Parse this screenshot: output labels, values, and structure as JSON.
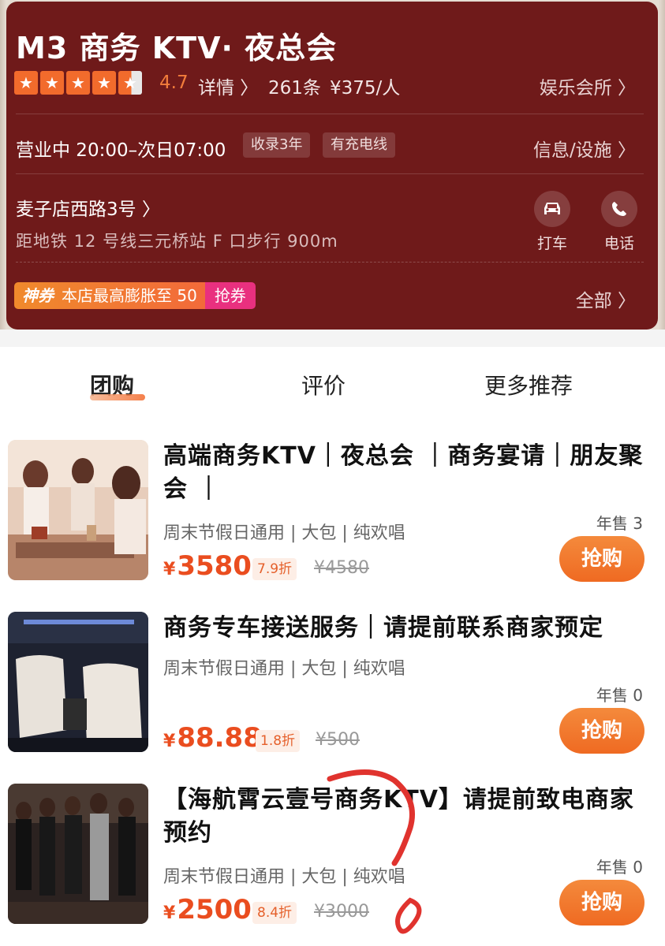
{
  "shop": {
    "name": "M3 商务 KTV· 夜总会",
    "rating": "4.7",
    "detail_link": "详情 〉",
    "review_count": "261条",
    "price_per_person": "¥375/人",
    "category_link": "娱乐会所 〉",
    "status": "营业中 20:00–次日07:00",
    "tags": [
      "收录3年",
      "有充电线"
    ],
    "info_link": "信息/设施 〉",
    "address": "麦子店西路3号 〉",
    "metro": "距地铁 12 号线三元桥站 F 口步行 900m",
    "actions": [
      {
        "label": "打车",
        "icon": "car-icon"
      },
      {
        "label": "电话",
        "icon": "phone-icon"
      }
    ],
    "coupon": {
      "badge": "神券",
      "text": "本店最高膨胀至 50",
      "action": "抢券"
    },
    "all_link": "全部 〉"
  },
  "tabs": [
    {
      "label": "团购",
      "active": true
    },
    {
      "label": "评价",
      "active": false
    },
    {
      "label": "更多推荐",
      "active": false
    }
  ],
  "deals": [
    {
      "title": "高端商务KTV｜夜总会 ｜商务宴请｜朋友聚会 ｜",
      "subtitle": "周末节假日通用 | 大包 | 纯欢唱",
      "sold": "年售 3",
      "price": "3580",
      "currency": "¥",
      "discount": "7.9折",
      "original_price": "¥4580",
      "button": "抢购"
    },
    {
      "title": "商务专车接送服务｜请提前联系商家预定",
      "subtitle": "周末节假日通用 | 大包 | 纯欢唱",
      "sold": "年售 0",
      "price": "88.88",
      "currency": "¥",
      "discount": "1.8折",
      "original_price": "¥500",
      "button": "抢购"
    },
    {
      "title": "【海航霄云壹号商务KTV】请提前致电商家预约",
      "subtitle": "周末节假日通用 | 大包 | 纯欢唱",
      "sold": "年售 0",
      "price": "2500",
      "currency": "¥",
      "discount": "8.4折",
      "original_price": "¥3000",
      "button": "抢购"
    }
  ],
  "colors": {
    "header_bg": "#6f1a1a",
    "accent": "#ea4d1f",
    "star": "#f26b2c",
    "coupon_pink": "#e9307f",
    "annotation_red": "#e0332e"
  }
}
